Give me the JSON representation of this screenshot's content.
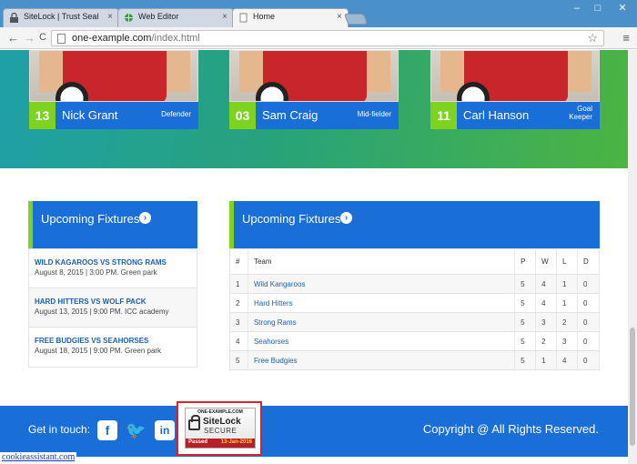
{
  "browser": {
    "tabs": [
      {
        "label": "SiteLock | Trust Seal",
        "icon": "lock-icon"
      },
      {
        "label": "Web Editor",
        "icon": "globe-icon"
      },
      {
        "label": "Home",
        "icon": "page-icon"
      }
    ],
    "close_glyph": "×",
    "url_host": "one-example.com",
    "url_path": "/index.html",
    "minimize": "–",
    "maximize": "□",
    "close": "✕",
    "back": "←",
    "forward": "→",
    "reload": "C",
    "star": "☆",
    "menu": "≡"
  },
  "players": [
    {
      "number": "13",
      "name": "Nick Grant",
      "position": "Defender"
    },
    {
      "number": "03",
      "name": "Sam Craig",
      "position": "Mid-fielder"
    },
    {
      "number": "11",
      "name": "Carl Hanson",
      "position": "Goal Keeper"
    }
  ],
  "fixtures_panel": {
    "title": "Upcoming Fixtures",
    "arrow": "›",
    "items": [
      {
        "title": "WILD KAGAROOS VS STRONG RAMS",
        "detail": "August 8, 2015 | 3:00 PM. Green park"
      },
      {
        "title": "HARD HITTERS VS WOLF PACK",
        "detail": "August 13, 2015 | 9:00 PM. ICC academy"
      },
      {
        "title": "FREE BUDGIES VS SEAHORSES",
        "detail": "August 18, 2015 | 9:00 PM. Green park"
      }
    ]
  },
  "standings_panel": {
    "title": "Upcoming Fixtures",
    "arrow": "›",
    "headers": [
      "#",
      "Team",
      "P",
      "W",
      "L",
      "D"
    ],
    "rows": [
      [
        "1",
        "Wild Kangaroos",
        "5",
        "4",
        "1",
        "0"
      ],
      [
        "2",
        "Hard Hitters",
        "5",
        "4",
        "1",
        "0"
      ],
      [
        "3",
        "Strong Rams",
        "5",
        "3",
        "2",
        "0"
      ],
      [
        "4",
        "Seahorses",
        "5",
        "2",
        "3",
        "0"
      ],
      [
        "5",
        "Free Budgies",
        "5",
        "1",
        "4",
        "0"
      ]
    ]
  },
  "footer": {
    "get_in_touch": "Get in touch:",
    "copyright": "Copyright @ All Rights Reserved.",
    "social": [
      {
        "icon": "facebook-icon",
        "glyph": "f"
      },
      {
        "icon": "twitter-icon",
        "glyph": "🐦"
      },
      {
        "icon": "linkedin-icon",
        "glyph": "in"
      }
    ]
  },
  "seal": {
    "domain": "ONE-EXAMPLE.COM",
    "brand": "SiteLock",
    "secure": "SECURE",
    "passed": "Passed",
    "date": "13-Jan-2016"
  },
  "cookie_link": "cookieassistant.com",
  "colors": {
    "brand_blue": "#1a6ed8",
    "accent_green": "#7ed321",
    "seal_red": "#d9242c"
  }
}
